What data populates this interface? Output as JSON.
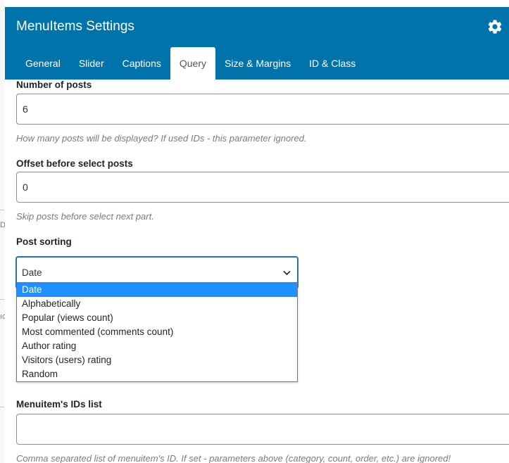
{
  "window": {
    "title": "MenuItems Settings",
    "accent_color": "#0073aa",
    "gear_icon": "gear-icon"
  },
  "tabs": [
    {
      "label": "General",
      "active": false
    },
    {
      "label": "Slider",
      "active": false
    },
    {
      "label": "Captions",
      "active": false
    },
    {
      "label": "Query",
      "active": true
    },
    {
      "label": "Size & Margins",
      "active": false
    },
    {
      "label": "ID & Class",
      "active": false
    }
  ],
  "form": {
    "num_posts": {
      "label": "Number of posts",
      "value": "6",
      "help": "How many posts will be displayed? If used IDs - this parameter ignored."
    },
    "offset": {
      "label": "Offset before select posts",
      "value": "0",
      "help": "Skip posts before select next part."
    },
    "sorting": {
      "label": "Post sorting",
      "value": "Date",
      "options": [
        "Date",
        "Alphabetically",
        "Popular (views count)",
        "Most commented (comments count)",
        "Author rating",
        "Visitors (users) rating",
        "Random"
      ],
      "selected_color": "#1e90ff"
    },
    "ids": {
      "label": "Menuitem's IDs list",
      "value": "",
      "help": "Comma separated list of menuitem's ID. If set - parameters above (category, count, order, etc.) are ignored!"
    }
  },
  "backdrop": {
    "marks": [
      "D",
      "ıc"
    ]
  }
}
